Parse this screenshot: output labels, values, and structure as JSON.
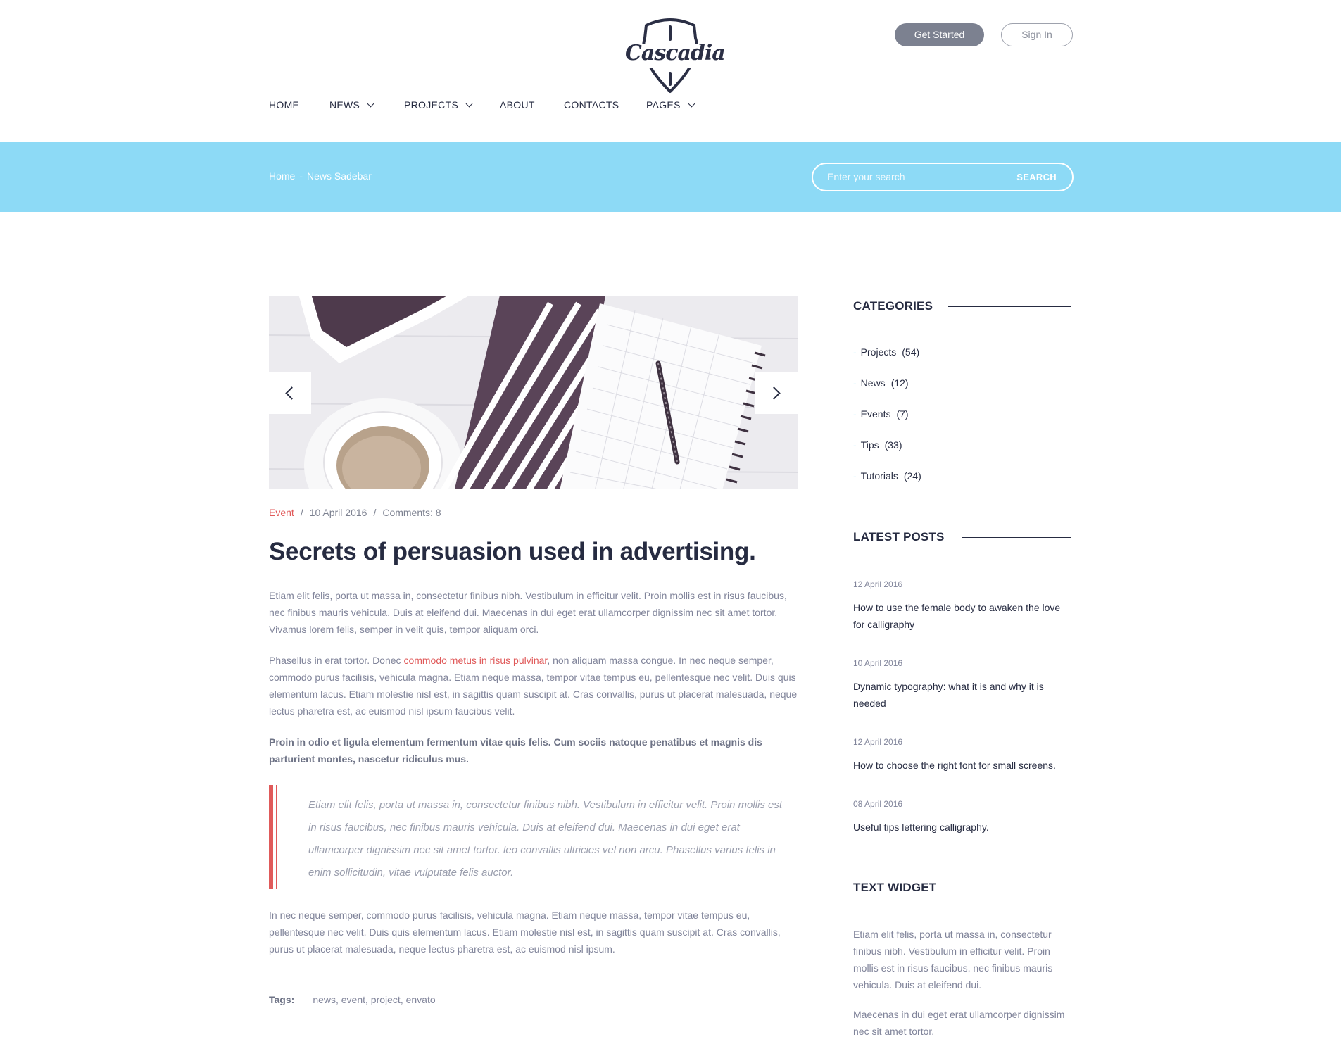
{
  "header": {
    "logo_text": "Cascadia",
    "get_started_label": "Get Started",
    "sign_in_label": "Sign In",
    "nav": [
      {
        "label": "HOME",
        "has_dropdown": false
      },
      {
        "label": "NEWS",
        "has_dropdown": true
      },
      {
        "label": "PROJECTS",
        "has_dropdown": true
      },
      {
        "label": "ABOUT",
        "has_dropdown": false
      },
      {
        "label": "CONTACTS",
        "has_dropdown": false
      },
      {
        "label": "PAGES",
        "has_dropdown": true
      }
    ]
  },
  "band": {
    "breadcrumb": {
      "home": "Home",
      "separator": "-",
      "current": "News Sadebar"
    },
    "search": {
      "placeholder": "Enter your search",
      "button_label": "SEARCH"
    }
  },
  "article": {
    "meta": {
      "category": "Event",
      "separator": "/",
      "date": "10 April 2016",
      "comments": "Comments: 8"
    },
    "title": "Secrets of persuasion used in advertising.",
    "para1": "Etiam elit felis, porta ut massa in, consectetur finibus nibh. Vestibulum in efficitur velit. Proin mollis est in risus faucibus, nec finibus mauris vehicula. Duis at eleifend dui. Maecenas in dui eget erat ullamcorper dignissim nec sit amet tortor. Vivamus lorem felis, semper in velit quis, tempor aliquam orci.",
    "para2_before": "Phasellus in erat tortor. Donec ",
    "para2_link": "commodo metus in risus pulvinar",
    "para2_after": ", non aliquam massa congue. In nec neque semper, commodo purus facilisis, vehicula magna. Etiam neque massa, tempor vitae tempus eu, pellentesque nec velit. Duis quis elementum lacus. Etiam molestie nisl est, in sagittis quam suscipit at. Cras convallis, purus ut placerat malesuada, neque lectus pharetra est, ac euismod nisl ipsum faucibus velit.",
    "para3_bold": "Proin in odio et ligula elementum fermentum vitae quis felis. Cum sociis natoque penatibus et magnis dis parturient montes, nascetur ridiculus mus.",
    "quote": "Etiam elit felis, porta ut massa in, consectetur finibus nibh. Vestibulum in efficitur velit. Proin mollis est in risus faucibus, nec finibus mauris vehicula. Duis at eleifend dui. Maecenas in dui eget erat ullamcorper dignissim nec sit amet tortor. leo convallis ultricies vel non arcu. Phasellus varius felis in enim sollicitudin, vitae vulputate felis auctor.",
    "para4": "In nec neque semper, commodo purus facilisis, vehicula magna. Etiam neque massa, tempor vitae tempus eu, pellentesque nec velit. Duis quis elementum lacus. Etiam molestie nisl est, in sagittis quam suscipit at. Cras convallis, purus ut placerat malesuada, neque lectus pharetra est, ac euismod nisl ipsum.",
    "tags_label": "Tags:",
    "tags": "news, event, project, envato"
  },
  "sidebar": {
    "categories_title": "CATEGORIES",
    "categories": [
      {
        "name": "Projects",
        "count": "(54)"
      },
      {
        "name": "News",
        "count": "(12)"
      },
      {
        "name": "Events",
        "count": "(7)"
      },
      {
        "name": "Tips",
        "count": "(33)"
      },
      {
        "name": "Tutorials",
        "count": "(24)"
      }
    ],
    "latest_title": "LATEST POSTS",
    "posts": [
      {
        "date": "12 April 2016",
        "title": "How to use the female body to awaken the love for calligraphy"
      },
      {
        "date": "10 April 2016",
        "title": "Dynamic typography: what it is and why it is needed"
      },
      {
        "date": "12 April 2016",
        "title": "How to choose the right font for small screens."
      },
      {
        "date": "08 April 2016",
        "title": "Useful tips lettering calligraphy."
      }
    ],
    "text_widget_title": "TEXT WIDGET",
    "text_widget_p1": "Etiam elit felis, porta ut massa in, consectetur finibus nibh. Vestibulum in efficitur velit. Proin mollis est in risus faucibus, nec finibus mauris vehicula. Duis at eleifend dui.",
    "text_widget_p2": "Maecenas in dui eget erat ullamcorper dignissim nec sit amet tortor."
  },
  "colors": {
    "accent_blue": "#8ddaf6",
    "accent_red": "#e05a5a",
    "dark": "#262b41",
    "gray_button": "#7c8190"
  },
  "icons": [
    "chevron-down-icon",
    "chevron-left-icon",
    "chevron-right-icon",
    "shield-logo-icon"
  ]
}
